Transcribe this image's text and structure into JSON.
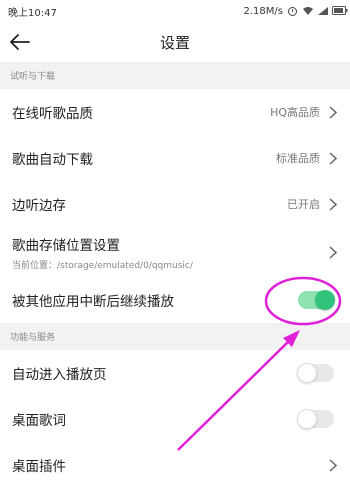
{
  "status_bar": {
    "time": "晚上10:47",
    "network_speed": "2.18M/s"
  },
  "header": {
    "title": "设置",
    "back_icon": "back-arrow-icon"
  },
  "sections": [
    {
      "header": "试听与下载",
      "rows": [
        {
          "label": "在线听歌品质",
          "value": "HQ高品质",
          "type": "chevron"
        },
        {
          "label": "歌曲自动下载",
          "value": "标准品质",
          "type": "chevron"
        },
        {
          "label": "边听边存",
          "value": "已开启",
          "type": "chevron"
        },
        {
          "label": "歌曲存储位置设置",
          "sublabel": "当前位置：/storage/emulated/0/qqmusic/",
          "type": "chevron"
        },
        {
          "label": "被其他应用中断后继续播放",
          "type": "toggle",
          "enabled": true
        }
      ]
    },
    {
      "header": "功能与服务",
      "rows": [
        {
          "label": "自动进入播放页",
          "type": "toggle",
          "enabled": false
        },
        {
          "label": "桌面歌词",
          "type": "toggle",
          "enabled": false
        },
        {
          "label": "桌面插件",
          "type": "chevron"
        }
      ]
    }
  ],
  "colors": {
    "accent": "#31c27c",
    "annotation": "#e020d8"
  }
}
